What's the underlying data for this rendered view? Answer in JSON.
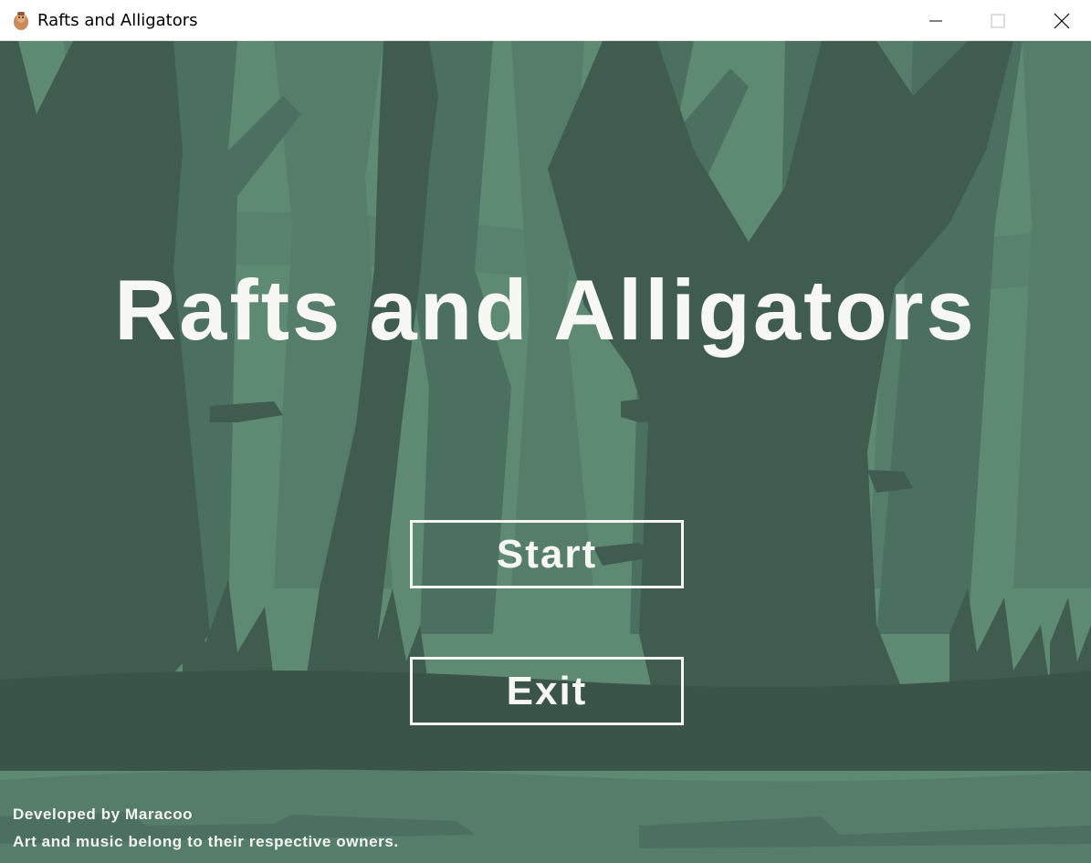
{
  "window": {
    "title": "Rafts and Alligators",
    "icon": "app-icon",
    "controls": [
      "minimize-icon",
      "maximize-icon",
      "close-icon"
    ]
  },
  "game": {
    "title": "Rafts and Alligators",
    "menu": {
      "start_label": "Start",
      "exit_label": "Exit"
    },
    "credits": {
      "developer": "Developed by Maracoo",
      "rights": "Art and music belong to their respective owners."
    }
  },
  "colors": {
    "sky": "#5e8a74",
    "far_trees": "#557d6a",
    "mid_trees": "#4b7060",
    "near_trees": "#3f5c4f",
    "ground": "#3a5448",
    "water": "#557d6a",
    "text": "#f7f7f4"
  }
}
